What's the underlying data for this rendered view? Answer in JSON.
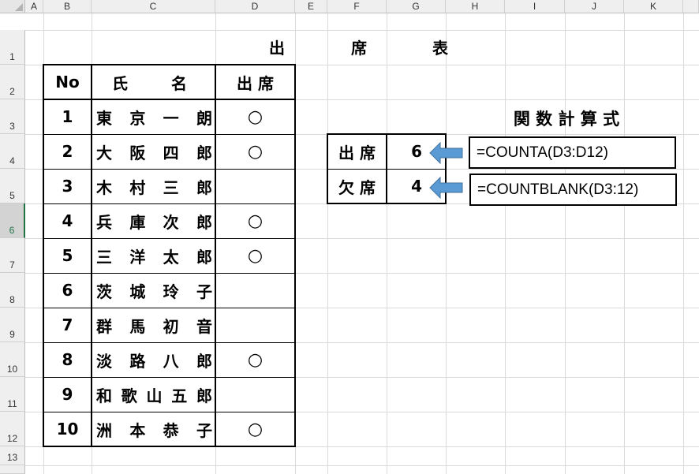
{
  "column_headers": [
    "A",
    "B",
    "C",
    "D",
    "E",
    "F",
    "G",
    "H",
    "I",
    "J",
    "K"
  ],
  "row_headers": [
    "1",
    "2",
    "3",
    "4",
    "5",
    "6",
    "7",
    "8",
    "9",
    "10",
    "11",
    "12",
    "13"
  ],
  "title_chars": [
    "出",
    "席",
    "表"
  ],
  "table": {
    "headers": {
      "no": "No",
      "name_chars": [
        "氏",
        "名"
      ],
      "attendance": "出 席"
    },
    "rows": [
      {
        "no": "1",
        "name": [
          "東",
          "京",
          "一",
          "朗"
        ],
        "mark": "○"
      },
      {
        "no": "2",
        "name": [
          "大",
          "阪",
          "四",
          "郎"
        ],
        "mark": "○"
      },
      {
        "no": "3",
        "name": [
          "木",
          "村",
          "三",
          "郎"
        ],
        "mark": ""
      },
      {
        "no": "4",
        "name": [
          "兵",
          "庫",
          "次",
          "郎"
        ],
        "mark": "○"
      },
      {
        "no": "5",
        "name": [
          "三",
          "洋",
          "太",
          "郎"
        ],
        "mark": "○"
      },
      {
        "no": "6",
        "name": [
          "茨",
          "城",
          "玲",
          "子"
        ],
        "mark": ""
      },
      {
        "no": "7",
        "name": [
          "群",
          "馬",
          "初",
          "音"
        ],
        "mark": ""
      },
      {
        "no": "8",
        "name": [
          "淡",
          "路",
          "八",
          "郎"
        ],
        "mark": "○"
      },
      {
        "no": "9",
        "name": [
          "和",
          "歌",
          "山",
          "五",
          "郎"
        ],
        "mark": ""
      },
      {
        "no": "10",
        "name": [
          "洲",
          "本",
          "恭",
          "子"
        ],
        "mark": "○"
      }
    ]
  },
  "summary": {
    "rows": [
      {
        "label": "出 席",
        "value": "6"
      },
      {
        "label": "欠 席",
        "value": "4"
      }
    ]
  },
  "formulas": {
    "heading": "関 数 計 算 式",
    "items": [
      "=COUNTA(D3:D12)",
      "=COUNTBLANK(D3:12)"
    ]
  },
  "colors": {
    "arrow_fill": "#5b9bd5",
    "arrow_stroke": "#41719c",
    "selected_row_header": "#217346"
  }
}
